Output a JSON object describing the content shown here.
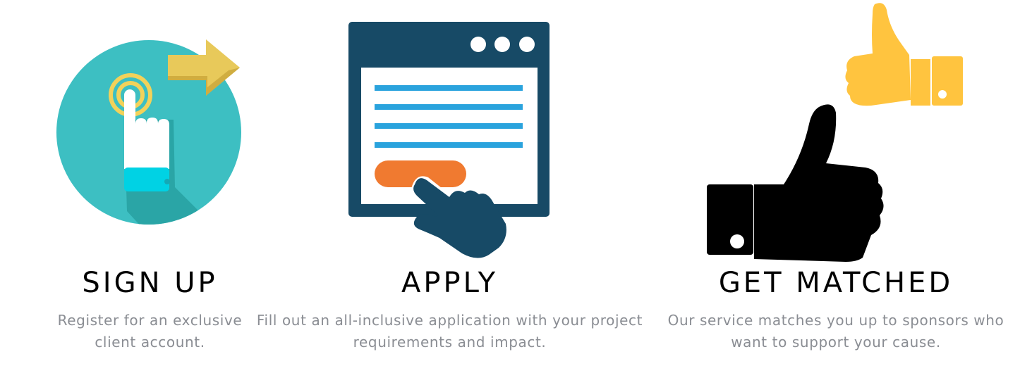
{
  "steps": [
    {
      "title": "SIGN UP",
      "description_lines": [
        "Register for an exclusive",
        "client account."
      ],
      "icon": "tap-finger-icon",
      "colors": {
        "circle": "#3dbfc2",
        "shadow": "#2aa5a6",
        "arrow": "#e8c95a",
        "cuff": "#00d2e4"
      }
    },
    {
      "title": "APPLY",
      "description_lines": [
        "Fill out an all-inclusive application with your project",
        "requirements and impact."
      ],
      "icon": "browser-form-icon",
      "colors": {
        "window": "#174a66",
        "lines": "#2aa3dd",
        "button": "#f07a30"
      }
    },
    {
      "title": "GET MATCHED",
      "description_lines": [
        "Our service matches you up to sponsors who",
        "want to support your cause."
      ],
      "icon": "thumbs-up-icon",
      "colors": {
        "big_thumb": "#000000",
        "small_thumb": "#ffc43f"
      }
    }
  ]
}
